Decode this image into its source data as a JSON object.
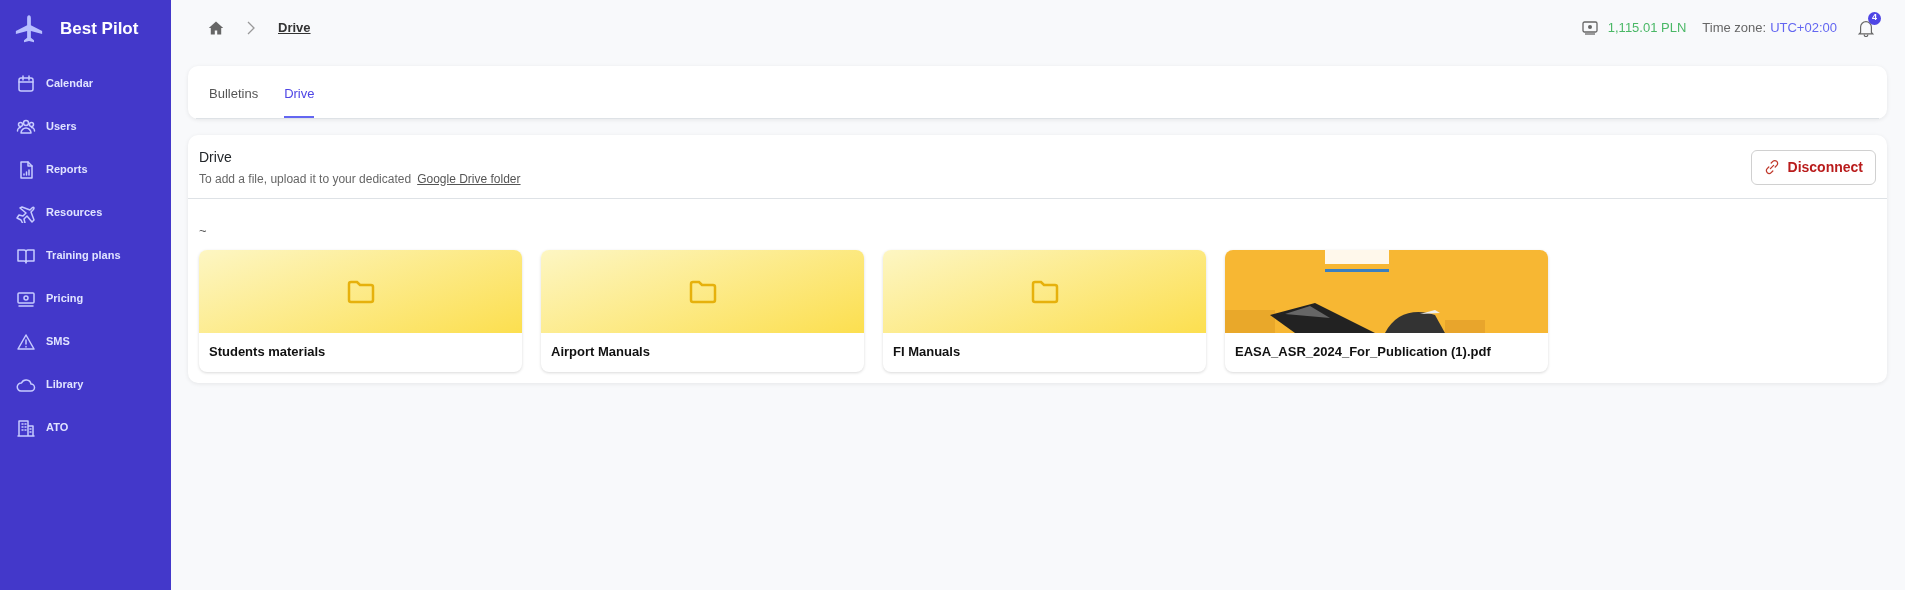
{
  "sidebar": {
    "brand": "Best Pilot",
    "items": [
      {
        "label": "Calendar"
      },
      {
        "label": "Users"
      },
      {
        "label": "Reports"
      },
      {
        "label": "Resources"
      },
      {
        "label": "Training plans"
      },
      {
        "label": "Pricing"
      },
      {
        "label": "SMS"
      },
      {
        "label": "Library"
      },
      {
        "label": "ATO"
      }
    ]
  },
  "header": {
    "breadcrumb": "Drive",
    "balance": "1,115.01 PLN",
    "timezone_label": "Time zone:",
    "timezone": "UTC+02:00",
    "notifications": "4"
  },
  "tabs": [
    {
      "label": "Bulletins",
      "selected": false
    },
    {
      "label": "Drive",
      "selected": true
    }
  ],
  "drive": {
    "title": "Drive",
    "hint": "To add a file, upload it to your dedicated",
    "link": "Google Drive folder",
    "disconnect": "Disconnect",
    "path": "~",
    "items": [
      {
        "kind": "folder",
        "name": "Students materials"
      },
      {
        "kind": "folder",
        "name": "Airport Manuals"
      },
      {
        "kind": "folder",
        "name": "FI Manuals"
      },
      {
        "kind": "file",
        "name": "EASA_ASR_2024_For_Publication (1).pdf"
      }
    ]
  }
}
